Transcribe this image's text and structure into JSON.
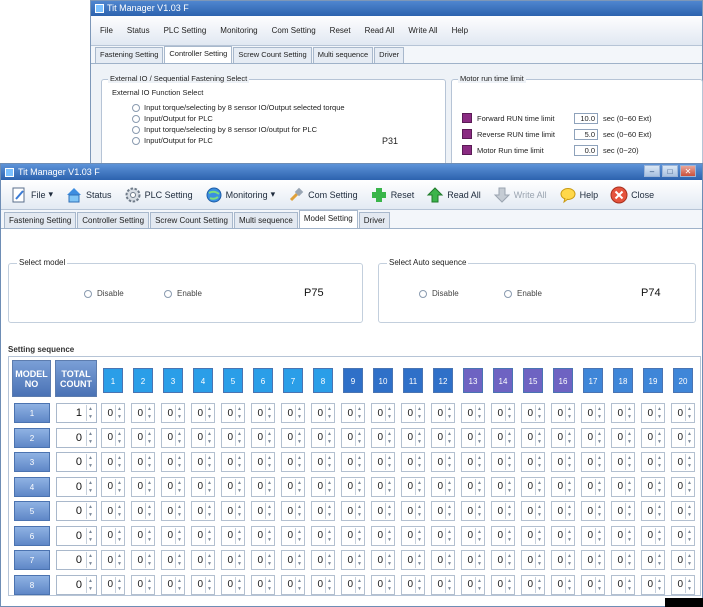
{
  "bg_window": {
    "title": "Tit Manager V1.03 F",
    "toolbar": [
      "File",
      "Status",
      "PLC Setting",
      "Monitoring",
      "Com Setting",
      "Reset",
      "Read All",
      "Write All",
      "Help"
    ],
    "tabs": [
      "Fastening Setting",
      "Controller Setting",
      "Screw Count Setting",
      "Multi sequence",
      "Driver"
    ],
    "active_tab": 1,
    "external_group": "External IO / Sequential Fastening Select",
    "external_sub": "External IO Function Select",
    "external_options": [
      "Input torque/selecting by 8 sensor IO/Output selected torque",
      "Input/Output for PLC",
      "Input torque/selecting by 8 sensor IO/output for PLC",
      "Input/Output for PLC"
    ],
    "external_code": "P31",
    "motor_group": "Motor run time limit",
    "motor_rows": [
      {
        "label": "Forward RUN time limit",
        "value": "10.0",
        "unit": "sec (0~60 Ext)"
      },
      {
        "label": "Reverse RUN time limit",
        "value": "5.0",
        "unit": "sec (0~60 Ext)"
      },
      {
        "label": "Motor Run time limit",
        "value": "0.0",
        "unit": "sec (0~20)"
      }
    ]
  },
  "main_window": {
    "title": "Tit Manager V1.03 F",
    "win_buttons": [
      "–",
      "□",
      "✕"
    ],
    "toolbar": {
      "file": "File",
      "status": "Status",
      "plc": "PLC Setting",
      "monitoring": "Monitoring",
      "com": "Com Setting",
      "reset": "Reset",
      "read_all": "Read All",
      "write_all": "Write All",
      "help": "Help",
      "close": "Close"
    },
    "tabs": [
      "Fastening Setting",
      "Controller Setting",
      "Screw Count Setting",
      "Multi sequence",
      "Model Setting",
      "Driver"
    ],
    "active_tab": 4,
    "select_model": {
      "legend": "Select model",
      "opt1": "Disable",
      "opt2": "Enable",
      "code": "P75"
    },
    "select_auto": {
      "legend": "Select Auto sequence",
      "opt1": "Disable",
      "opt2": "Enable",
      "code": "P74"
    },
    "setting_sequence_label": "Setting sequence",
    "header_model": [
      "MODEL",
      "NO"
    ],
    "header_total": [
      "TOTAL",
      "COUNT"
    ],
    "columns": [
      "1",
      "2",
      "3",
      "4",
      "5",
      "6",
      "7",
      "8",
      "9",
      "10",
      "11",
      "12",
      "13",
      "14",
      "15",
      "16",
      "17",
      "18",
      "19",
      "20"
    ],
    "rows": [
      {
        "model": "1",
        "total": "1"
      },
      {
        "model": "2",
        "total": "0"
      },
      {
        "model": "3",
        "total": "0"
      },
      {
        "model": "4",
        "total": "0"
      },
      {
        "model": "5",
        "total": "0"
      },
      {
        "model": "6",
        "total": "0"
      },
      {
        "model": "7",
        "total": "0"
      },
      {
        "model": "8",
        "total": "0"
      }
    ],
    "cell_value": "0",
    "colors": {
      "col_light": "#2a9ee8",
      "col_mid": "#2f70c8",
      "col_purple": "#6e63c2",
      "col_blue": "#3f86d8"
    }
  }
}
